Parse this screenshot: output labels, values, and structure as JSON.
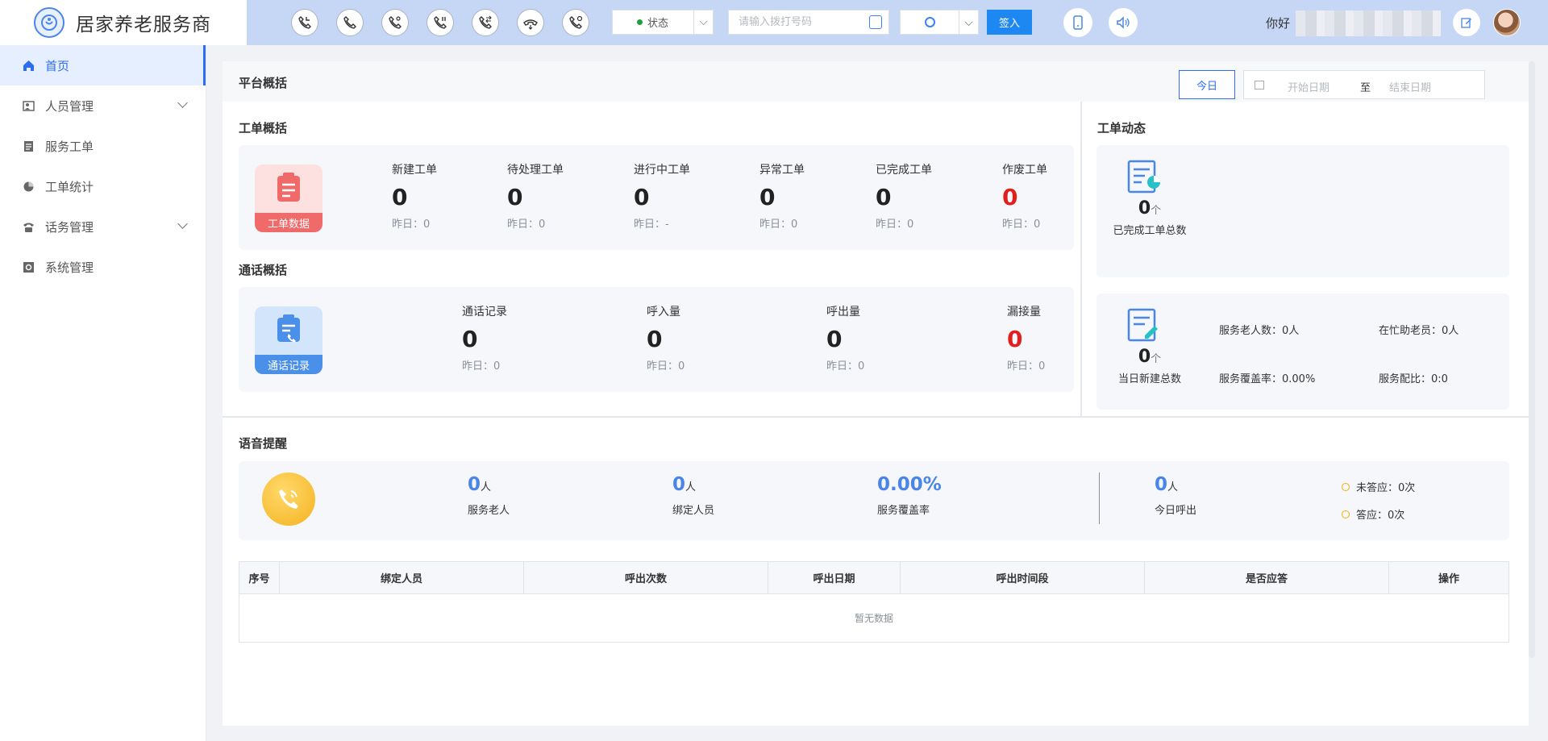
{
  "app": {
    "title": "居家养老服务商"
  },
  "toolbar": {
    "status_label": "状态",
    "dial_placeholder": "请输入拨打号码",
    "signin_label": "签入",
    "greeting": "你好"
  },
  "sidebar": {
    "items": [
      {
        "label": "首页",
        "active": true
      },
      {
        "label": "人员管理",
        "expandable": true
      },
      {
        "label": "服务工单"
      },
      {
        "label": "工单统计"
      },
      {
        "label": "话务管理",
        "expandable": true
      },
      {
        "label": "系统管理"
      }
    ]
  },
  "overview": {
    "title": "平台概括",
    "today_label": "今日",
    "start_placeholder": "开始日期",
    "to_label": "至",
    "end_placeholder": "结束日期"
  },
  "workorders": {
    "title": "工单概括",
    "badge": "工单数据",
    "stats": [
      {
        "name": "新建工单",
        "value": "0",
        "yesterday": "昨日：0"
      },
      {
        "name": "待处理工单",
        "value": "0",
        "yesterday": "昨日：0"
      },
      {
        "name": "进行中工单",
        "value": "0",
        "yesterday": "昨日：-"
      },
      {
        "name": "异常工单",
        "value": "0",
        "yesterday": "昨日：0"
      },
      {
        "name": "已完成工单",
        "value": "0",
        "yesterday": "昨日：0"
      },
      {
        "name": "作废工单",
        "value": "0",
        "yesterday": "昨日：0"
      }
    ]
  },
  "calls": {
    "title": "通话概括",
    "badge": "通话记录",
    "stats": [
      {
        "name": "通话记录",
        "value": "0",
        "yesterday": "昨日：0"
      },
      {
        "name": "呼入量",
        "value": "0",
        "yesterday": "昨日：0"
      },
      {
        "name": "呼出量",
        "value": "0",
        "yesterday": "昨日：0"
      },
      {
        "name": "漏接量",
        "value": "0",
        "yesterday": "昨日：0"
      }
    ]
  },
  "dynamics": {
    "title": "工单动态",
    "completed": {
      "value": "0",
      "unit": "个",
      "label": "已完成工单总数"
    },
    "created": {
      "value": "0",
      "unit": "个",
      "label": "当日新建总数"
    },
    "metrics": [
      "服务老人数：0人",
      "在忙助老员：0人",
      "服务覆盖率：0.00%",
      "服务配比：0:0"
    ]
  },
  "voice": {
    "title": "语音提醒",
    "stats": [
      {
        "value": "0",
        "unit": "人",
        "label": "服务老人"
      },
      {
        "value": "0",
        "unit": "人",
        "label": "绑定人员"
      },
      {
        "value": "0.00%",
        "unit": "",
        "label": "服务覆盖率"
      },
      {
        "value": "0",
        "unit": "人",
        "label": "今日呼出"
      }
    ],
    "unanswered": "未答应：0次",
    "answered": "答应：0次"
  },
  "table": {
    "columns": [
      "序号",
      "绑定人员",
      "呼出次数",
      "呼出日期",
      "呼出时间段",
      "是否应答",
      "操作"
    ],
    "empty_text": "暂无数据"
  },
  "colors": {
    "accent": "#2d6df0",
    "topbar": "#c5d7f5",
    "alert_red": "#e02020",
    "workorder_badge": "#f06a6a",
    "call_badge": "#4a90e8"
  }
}
